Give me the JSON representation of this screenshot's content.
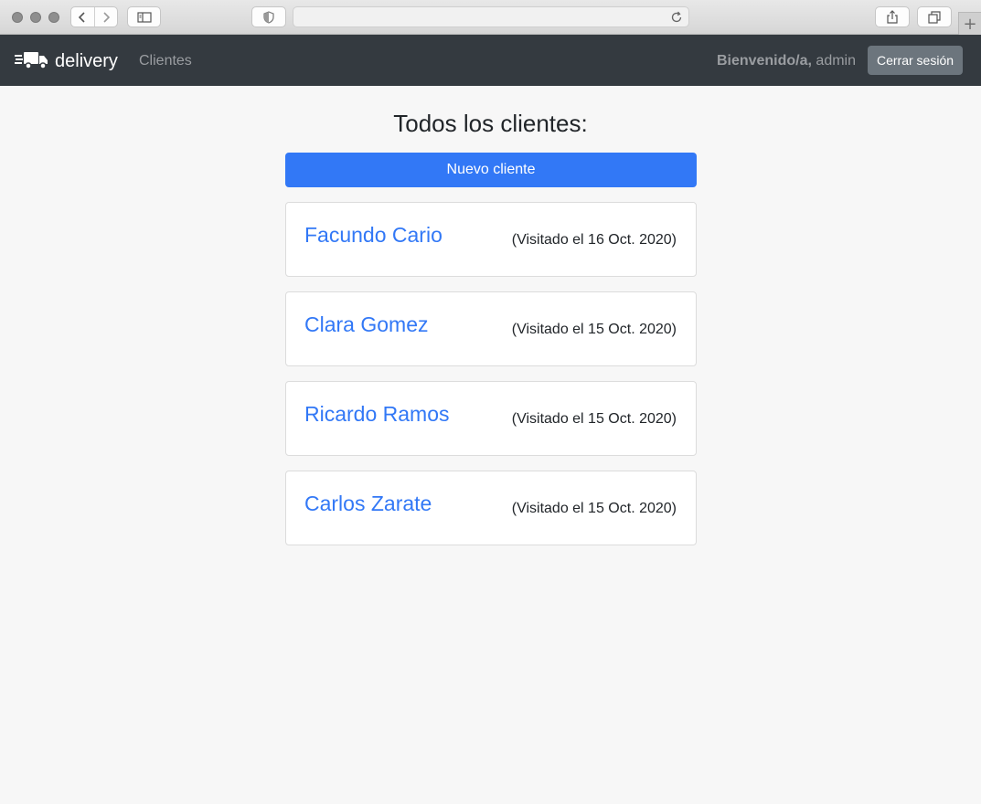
{
  "browser": {
    "url": ""
  },
  "navbar": {
    "brand": "delivery",
    "brand_icon": "delivery-truck-icon",
    "link": "Clientes",
    "welcome_bold": "Bienvenido/a,",
    "welcome_user": "admin",
    "logout_label": "Cerrar sesión"
  },
  "main": {
    "title": "Todos los clientes:",
    "new_button": "Nuevo cliente",
    "clients": [
      {
        "name": "Facundo Cario",
        "visited": "(Visitado el 16 Oct. 2020)"
      },
      {
        "name": "Clara Gomez",
        "visited": "(Visitado el 15 Oct. 2020)"
      },
      {
        "name": "Ricardo Ramos",
        "visited": "(Visitado el 15 Oct. 2020)"
      },
      {
        "name": "Carlos Zarate",
        "visited": "(Visitado el 15 Oct. 2020)"
      }
    ]
  },
  "colors": {
    "navbar_bg": "#343a40",
    "primary": "#3278f6",
    "secondary": "#6c757d"
  }
}
